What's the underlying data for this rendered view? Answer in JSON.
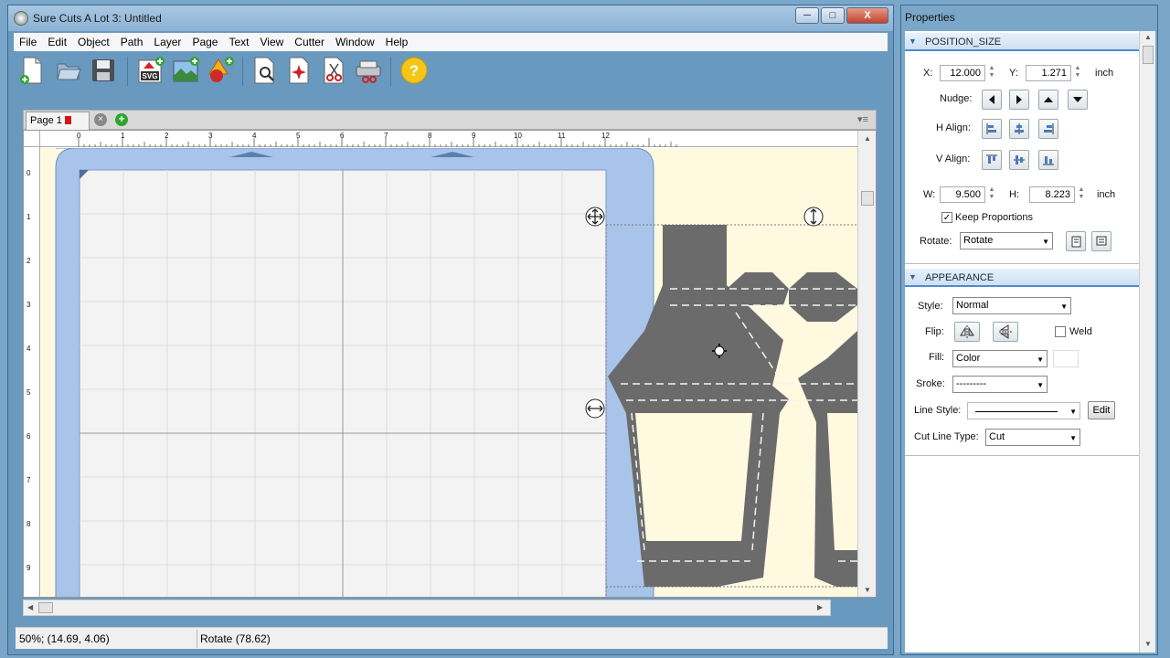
{
  "window": {
    "title": "Sure Cuts A Lot 3: Untitled",
    "minimize": "─",
    "maximize": "□",
    "close": "X"
  },
  "menu": [
    "File",
    "Edit",
    "Object",
    "Path",
    "Layer",
    "Page",
    "Text",
    "View",
    "Cutter",
    "Window",
    "Help"
  ],
  "toolbar": {
    "icons": [
      "new-document-icon",
      "open-icon",
      "save-icon",
      "import-svg-icon",
      "import-image-icon",
      "add-shape-icon",
      "preview-icon",
      "laser-icon",
      "cut-icon",
      "cutter-icon",
      "help-icon"
    ],
    "svg_badge": "SVG",
    "help_glyph": "?"
  },
  "document": {
    "tab_label": "Page 1",
    "tab_close": "×",
    "tab_add": "+",
    "ruler_h": [
      "0",
      "1",
      "2",
      "3",
      "4",
      "5",
      "6",
      "7",
      "8",
      "9",
      "10",
      "11",
      "12"
    ],
    "ruler_v": [
      "0",
      "1",
      "2",
      "3",
      "4",
      "5",
      "6",
      "7",
      "8",
      "9"
    ]
  },
  "status": {
    "left": "50%; (14.69, 4.06)",
    "right": "Rotate (78.62)"
  },
  "properties": {
    "title": "Properties",
    "position_size": {
      "header": "POSITION_SIZE",
      "x_label": "X:",
      "x_value": "12.000",
      "y_label": "Y:",
      "y_value": "1.271",
      "unit": "inch",
      "nudge_label": "Nudge:",
      "halign_label": "H Align:",
      "valign_label": "V Align:",
      "w_label": "W:",
      "w_value": "9.500",
      "h_label": "H:",
      "h_value": "8.223",
      "unit2": "inch",
      "keep_proportions": "Keep Proportions",
      "keep_proportions_checked": true,
      "rotate_label": "Rotate:",
      "rotate_value": "Rotate"
    },
    "appearance": {
      "header": "APPEARANCE",
      "style_label": "Style:",
      "style_value": "Normal",
      "flip_label": "Flip:",
      "weld_label": "Weld",
      "fill_label": "Fill:",
      "fill_value": "Color",
      "stroke_label": "Sroke:",
      "stroke_value": "---------",
      "line_style_label": "Line Style:",
      "edit_button": "Edit",
      "cut_line_type_label": "Cut Line Type:",
      "cut_line_type_value": "Cut"
    }
  },
  "colors": {
    "accent": "#4f8bd0",
    "shape_fill": "#6b6b6b",
    "mat_blue": "#a9c4ea",
    "canvas_bg": "#fff9e0"
  }
}
